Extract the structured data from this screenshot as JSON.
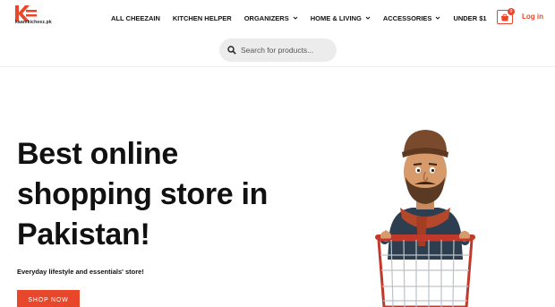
{
  "brand": {
    "logo_text": "kaamkicheez.pk",
    "accent": "#e8472b"
  },
  "nav": {
    "items": [
      {
        "label": "ALL CHEEZAIN",
        "dropdown": false
      },
      {
        "label": "KITCHEN HELPER",
        "dropdown": false
      },
      {
        "label": "ORGANIZERS",
        "dropdown": true
      },
      {
        "label": "HOME & LIVING",
        "dropdown": true
      },
      {
        "label": "ACCESSORIES",
        "dropdown": true
      },
      {
        "label": "UNDER $1",
        "dropdown": false
      }
    ]
  },
  "cart": {
    "count": "0",
    "icon": "shopping-bag-icon"
  },
  "login_label": "Log in",
  "search": {
    "placeholder": "Search for products..."
  },
  "hero": {
    "title_lines": [
      "Best online",
      "shopping store in",
      "Pakistan!"
    ],
    "subtitle": "Everyday lifestyle and essentials' store!",
    "cta_label": "SHOP NOW",
    "image": "man-with-shopping-cart-illustration"
  }
}
